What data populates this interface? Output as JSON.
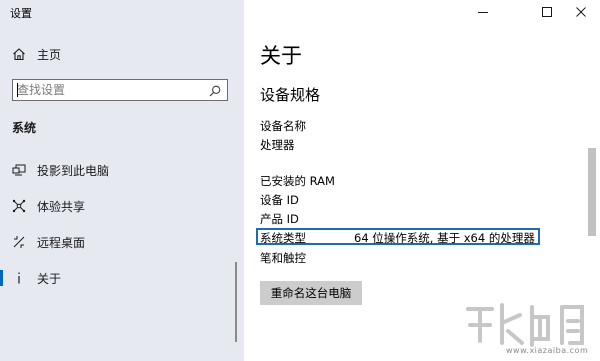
{
  "window": {
    "title": "设置"
  },
  "sidebar": {
    "home_label": "主页",
    "search_placeholder": "查找设置",
    "section_heading": "系统",
    "items": [
      {
        "label": "投影到此电脑",
        "icon": "projector-icon"
      },
      {
        "label": "体验共享",
        "icon": "shared-experience-icon"
      },
      {
        "label": "远程桌面",
        "icon": "remote-desktop-icon"
      },
      {
        "label": "关于",
        "icon": "info-icon",
        "selected": true
      }
    ]
  },
  "main": {
    "title": "关于",
    "subheading": "设备规格",
    "specs": [
      {
        "label": "设备名称",
        "value": ""
      },
      {
        "label": "处理器",
        "value": ""
      },
      {
        "label": "已安装的 RAM",
        "value": ""
      },
      {
        "label": "设备 ID",
        "value": ""
      },
      {
        "label": "产品 ID",
        "value": ""
      },
      {
        "label": "系统类型",
        "value": "64 位操作系统, 基于 x64 的处理器"
      },
      {
        "label": "笔和触控",
        "value": ""
      }
    ],
    "rename_button": "重命名这台电脑"
  },
  "watermark": {
    "url": "www.xiazaiba.com"
  },
  "colors": {
    "sidebar_bg": "#e6eaf0",
    "accent": "#0067c0",
    "highlight_border": "#1e6bb0"
  }
}
